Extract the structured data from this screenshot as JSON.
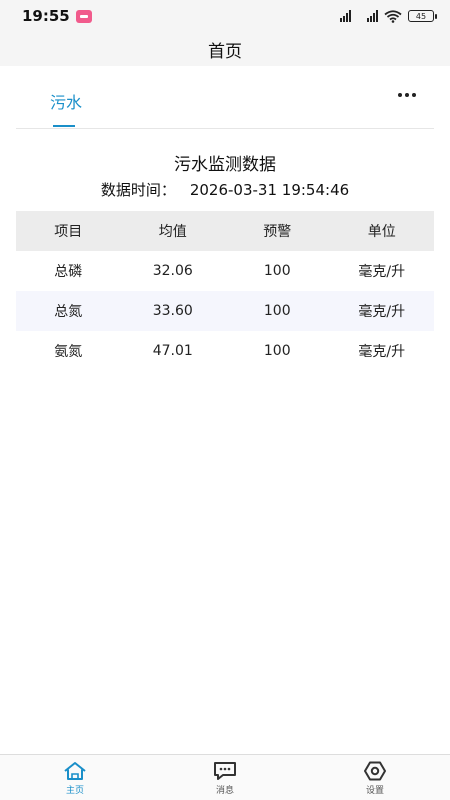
{
  "status_bar": {
    "time": "19:55",
    "battery": "45"
  },
  "header": {
    "title": "首页"
  },
  "tabs": [
    {
      "label": "污水"
    }
  ],
  "monitor": {
    "title": "污水监测数据",
    "time_label": "数据时间：",
    "time_value": "2026-03-31 19:54:46"
  },
  "table": {
    "headers": [
      "项目",
      "均值",
      "预警",
      "单位"
    ],
    "rows": [
      [
        "总磷",
        "32.06",
        "100",
        "毫克/升"
      ],
      [
        "总氮",
        "33.60",
        "100",
        "毫克/升"
      ],
      [
        "氨氮",
        "47.01",
        "100",
        "毫克/升"
      ]
    ]
  },
  "bottom_nav": [
    {
      "label": "主页",
      "icon": "home-icon",
      "active": true
    },
    {
      "label": "消息",
      "icon": "message-icon",
      "active": false
    },
    {
      "label": "设置",
      "icon": "gear-icon",
      "active": false
    }
  ],
  "colors": {
    "accent": "#1a8fc9",
    "header_bg": "#f5f5f5",
    "table_header_bg": "#ececec",
    "table_alt_bg": "#f5f6fd"
  }
}
